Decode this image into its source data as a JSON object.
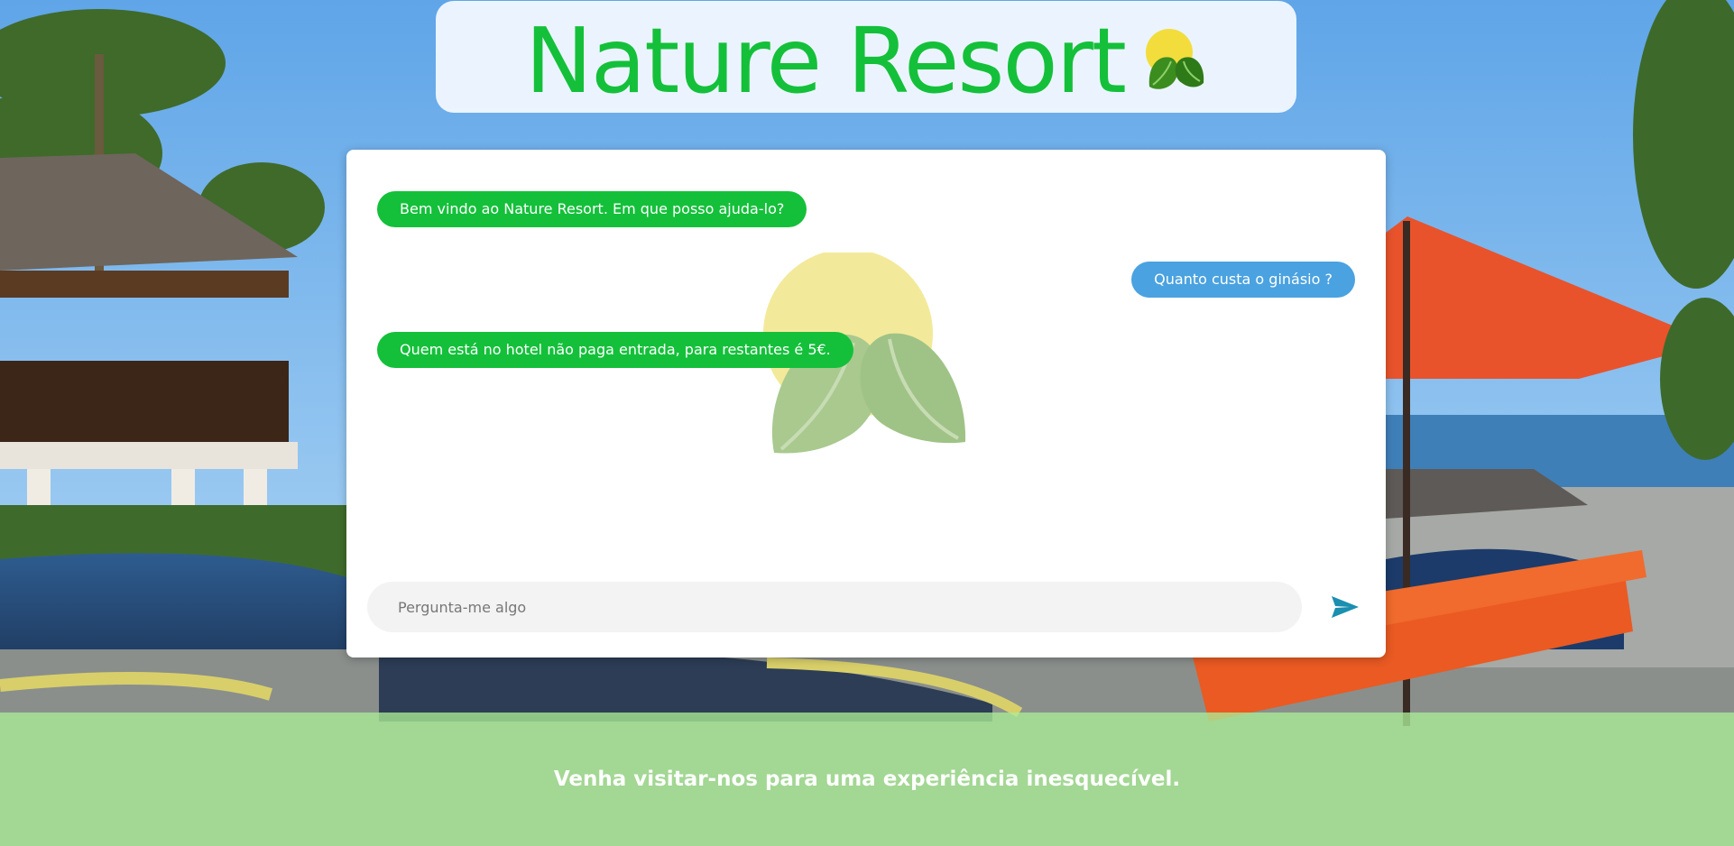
{
  "header": {
    "title": "Nature Resort",
    "logo_icon": "sun-leaves-logo-icon"
  },
  "chat": {
    "messages": [
      {
        "sender": "bot",
        "text": "Bem vindo ao Nature Resort. Em que posso ajuda-lo?"
      },
      {
        "sender": "user",
        "text": "Quanto custa o ginásio ?"
      },
      {
        "sender": "bot",
        "text": "Quem está no hotel não paga entrada, para restantes é 5€."
      }
    ],
    "input": {
      "value": "",
      "placeholder": "Pergunta-me algo"
    },
    "send_icon": "send-arrow-icon"
  },
  "footer": {
    "text": "Venha visitar-nos para uma experiência inesquecível."
  },
  "colors": {
    "brand_green": "#14c03a",
    "user_bubble_blue": "#4aa2e0",
    "send_icon": "#1a8fb0",
    "footer_green": "#aaec96"
  }
}
